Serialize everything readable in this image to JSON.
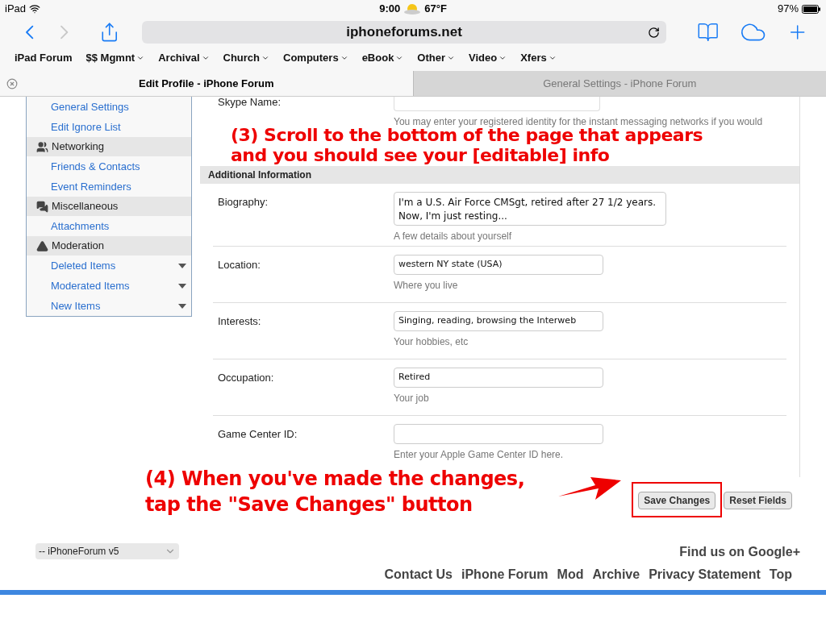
{
  "status_bar": {
    "device": "iPad",
    "time": "9:00",
    "temperature": "67°F",
    "battery": "97%"
  },
  "address_bar": {
    "url": "iphoneforums.net"
  },
  "bookmarks": [
    {
      "label": "iPad Forum",
      "has_menu": false
    },
    {
      "label": "$$ Mgmnt",
      "has_menu": true
    },
    {
      "label": "Archival",
      "has_menu": true
    },
    {
      "label": "Church",
      "has_menu": true
    },
    {
      "label": "Computers",
      "has_menu": true
    },
    {
      "label": "eBook",
      "has_menu": true
    },
    {
      "label": "Other",
      "has_menu": true
    },
    {
      "label": "Video",
      "has_menu": true
    },
    {
      "label": "Xfers",
      "has_menu": true
    }
  ],
  "tabs": [
    {
      "label": "Edit Profile - iPhone Forum",
      "selected": true
    },
    {
      "label": "General Settings - iPhone Forum",
      "selected": false
    }
  ],
  "sidebar": {
    "items": [
      {
        "kind": "link",
        "label": "General Settings",
        "has_menu": false
      },
      {
        "kind": "link",
        "label": "Edit Ignore List",
        "has_menu": false
      },
      {
        "kind": "header",
        "label": "Networking"
      },
      {
        "kind": "link",
        "label": "Friends & Contacts",
        "has_menu": false
      },
      {
        "kind": "link",
        "label": "Event Reminders",
        "has_menu": false
      },
      {
        "kind": "header",
        "label": "Miscellaneous"
      },
      {
        "kind": "link",
        "label": "Attachments",
        "has_menu": false
      },
      {
        "kind": "header",
        "label": "Moderation"
      },
      {
        "kind": "link",
        "label": "Deleted Items",
        "has_menu": true
      },
      {
        "kind": "link",
        "label": "Moderated Items",
        "has_menu": true
      },
      {
        "kind": "link",
        "label": "New Items",
        "has_menu": true
      }
    ]
  },
  "skype": {
    "label": "Skype Name:",
    "hint": "You may enter your registered identity for the instant messaging networks if you would"
  },
  "section_header": "Additional Information",
  "fields": [
    {
      "kind": "textarea",
      "label": "Biography:",
      "lines": [
        "I'm a U.S. Air Force CMSgt, retired after 27 1/2 years.",
        "Now, I'm just resting..."
      ],
      "hint": "A few details about yourself"
    },
    {
      "kind": "input",
      "label": "Location:",
      "lines": [
        "western NY state (USA)"
      ],
      "hint": "Where you live"
    },
    {
      "kind": "input",
      "label": "Interests:",
      "lines": [
        "Singing, reading, browsing the Interweb"
      ],
      "hint": "Your hobbies, etc"
    },
    {
      "kind": "input",
      "label": "Occupation:",
      "lines": [
        "Retired"
      ],
      "hint": "Your job"
    },
    {
      "kind": "input",
      "label": "Game Center ID:",
      "hint": "Enter your Apple Game Center ID here."
    }
  ],
  "buttons": [
    {
      "label": "Save Changes",
      "highlighted": true
    },
    {
      "label": "Reset Fields",
      "highlighted": false
    }
  ],
  "annotations": [
    {
      "lines": [
        "(3) Scroll to the bottom of the page that appears",
        "and you should see your [editable] info"
      ]
    },
    {
      "lines": [
        "(4) When you've made the changes,",
        "tap the \"Save Changes\" button"
      ]
    }
  ],
  "footer": {
    "style_select": "-- iPhoneForum v5",
    "google": "Find us on Google+",
    "links": [
      "Contact Us",
      "iPhone Forum",
      "Mod",
      "Archive",
      "Privacy Statement",
      "Top"
    ]
  }
}
